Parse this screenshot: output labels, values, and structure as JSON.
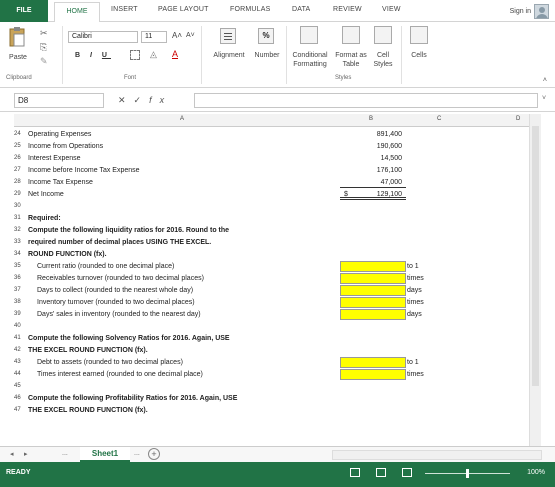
{
  "ribbon_tabs": {
    "file": "FILE",
    "home": "HOME",
    "insert": "INSERT",
    "page_layout": "PAGE LAYOUT",
    "formulas": "FORMULAS",
    "data": "DATA",
    "review": "REVIEW",
    "view": "VIEW",
    "sign_in": "Sign in"
  },
  "ribbon": {
    "paste": "Paste",
    "clipboard": "Clipboard",
    "font_name": "Calibri",
    "font_size": "11",
    "font_group": "Font",
    "bold": "B",
    "italic": "I",
    "underline": "U",
    "alignment": "Alignment",
    "number": "Number",
    "conditional": "Conditional",
    "formatting": "Formatting",
    "format_as": "Format as",
    "table": "Table",
    "cell": "Cell",
    "styles_btn": "Styles",
    "styles_group": "Styles",
    "cells": "Cells",
    "percent": "%"
  },
  "formula_bar": {
    "name_box": "D8",
    "fx": "fx"
  },
  "columns": [
    "A",
    "B",
    "C",
    "D"
  ],
  "rows": [
    {
      "n": "24",
      "a": "Operating Expenses",
      "b": "891,400"
    },
    {
      "n": "25",
      "a": "Income from Operations",
      "b": "190,600"
    },
    {
      "n": "26",
      "a": "Interest Expense",
      "b": "14,500"
    },
    {
      "n": "27",
      "a": "Income before Income Tax Expense",
      "b": "176,100"
    },
    {
      "n": "28",
      "a": "Income Tax Expense",
      "b": "47,000"
    },
    {
      "n": "29",
      "a": "Net Income",
      "cur": "$",
      "b": "129,100"
    },
    {
      "n": "30",
      "a": ""
    },
    {
      "n": "31",
      "a": "Required:",
      "bold": true
    },
    {
      "n": "32",
      "a": "Compute the following liquidity ratios for 2016. Round to the",
      "bold": true
    },
    {
      "n": "33",
      "a": "required number of decimal places USING THE EXCEL.",
      "bold": true
    },
    {
      "n": "34",
      "a": "ROUND FUNCTION (fx).",
      "bold": true
    },
    {
      "n": "35",
      "a": "Current ratio (rounded to one decimal place)",
      "ind": true,
      "hl": true,
      "c": "to 1"
    },
    {
      "n": "36",
      "a": "Receivables turnover (rounded to two decimal places)",
      "ind": true,
      "hl": true,
      "c": "times"
    },
    {
      "n": "37",
      "a": "Days to collect (rounded to the nearest whole day)",
      "ind": true,
      "hl": true,
      "c": "days"
    },
    {
      "n": "38",
      "a": "Inventory turnover (rounded to two decimal places)",
      "ind": true,
      "hl": true,
      "c": "times"
    },
    {
      "n": "39",
      "a": "Days' sales in inventory (rounded to the nearest day)",
      "ind": true,
      "hl": true,
      "c": "days"
    },
    {
      "n": "40",
      "a": ""
    },
    {
      "n": "41",
      "a": "Compute the following Solvency Ratios for 2016. Again, USE",
      "bold": true
    },
    {
      "n": "42",
      "a": "THE EXCEL ROUND FUNCTION (fx).",
      "bold": true
    },
    {
      "n": "43",
      "a": "Debt to assets (rounded to two decimal places)",
      "ind": true,
      "hl": true,
      "c": "to 1"
    },
    {
      "n": "44",
      "a": "Times interest earned (rounded to one decimal place)",
      "ind": true,
      "hl": true,
      "c": "times"
    },
    {
      "n": "45",
      "a": ""
    },
    {
      "n": "46",
      "a": "Compute the following Profitability Ratios for 2016. Again, USE",
      "bold": true
    },
    {
      "n": "47",
      "a": "THE EXCEL ROUND FUNCTION (fx).",
      "bold": true
    }
  ],
  "sheet_tabs": {
    "active": "Sheet1",
    "ellipsis_left": "...",
    "ellipsis_right": "...",
    "add": "+"
  },
  "status_bar": {
    "ready": "READY",
    "zoom": "100%"
  },
  "colors": {
    "accent": "#217346",
    "highlight": "#ffff00"
  }
}
